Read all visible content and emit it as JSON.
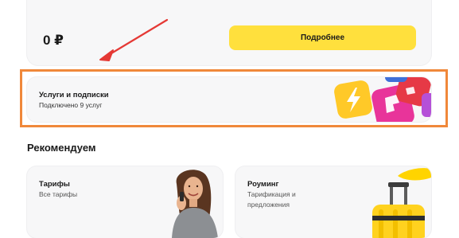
{
  "balance": {
    "amount": "0 ₽",
    "details_label": "Подробнее"
  },
  "services": {
    "title": "Услуги и подписки",
    "subtitle": "Подключено 9 услуг"
  },
  "recommend": {
    "heading": "Рекомендуем",
    "cards": [
      {
        "title": "Тарифы",
        "subtitle": "Все тарифы"
      },
      {
        "title": "Роуминг",
        "subtitle": "Тарификация и предложения"
      }
    ]
  },
  "colors": {
    "accent_yellow": "#ffe03d",
    "highlight_orange": "#f0883a",
    "arrow_red": "#e53935",
    "card_bg": "#f7f7f8"
  },
  "icons": [
    "lightning-icon",
    "arrow-annotation"
  ]
}
